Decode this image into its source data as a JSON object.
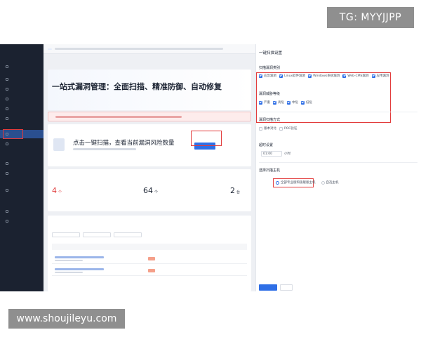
{
  "watermarks": {
    "top": "TG: MYYJJPP",
    "bottom": "www.shoujileyu.com"
  },
  "sidebar": {
    "title": "",
    "footer": ""
  },
  "main": {
    "breadcrumb": "",
    "hero_title": "一站式漏洞管理：全面扫描、精准防御、自动修复",
    "scan_prompt": "点击一键扫描，查看当前漏洞风险数量",
    "overview": {
      "cards": [
        {
          "value": "4",
          "unit": "个",
          "status": "red"
        },
        {
          "value": "64",
          "unit": "个",
          "status": "normal"
        },
        {
          "value": "2",
          "unit": "台",
          "status": "normal"
        }
      ]
    }
  },
  "panel": {
    "title": "一键扫描设置",
    "scan_types": {
      "label": "扫描漏洞类别",
      "options": [
        {
          "label": "应急漏洞",
          "checked": true
        },
        {
          "label": "Linux软件漏洞",
          "checked": true
        },
        {
          "label": "Windows系统漏洞",
          "checked": true
        },
        {
          "label": "Web-CMS漏洞",
          "checked": true
        },
        {
          "label": "应用漏洞",
          "checked": true
        }
      ]
    },
    "severity": {
      "label": "漏洞威胁等级",
      "options": [
        {
          "label": "严重",
          "checked": true
        },
        {
          "label": "高危",
          "checked": true
        },
        {
          "label": "中危",
          "checked": true
        },
        {
          "label": "低危",
          "checked": true
        }
      ]
    },
    "scan_method": {
      "label": "漏洞扫描方式",
      "options": [
        {
          "label": "版本对比",
          "checked": false
        },
        {
          "label": "POC验证",
          "checked": false
        }
      ]
    },
    "timeout": {
      "label": "超时设置",
      "value": "01:00",
      "unit": "小时"
    },
    "hosts": {
      "label": "选择扫描主机",
      "options": [
        {
          "label": "全部专业版和旗舰版主机",
          "selected": true
        },
        {
          "label": "自选主机",
          "selected": false
        }
      ]
    }
  },
  "colors": {
    "accent": "#2f6fe6",
    "danger": "#e03a3a",
    "sidebar": "#1b2230",
    "highlight_box": "#e23b3b"
  }
}
